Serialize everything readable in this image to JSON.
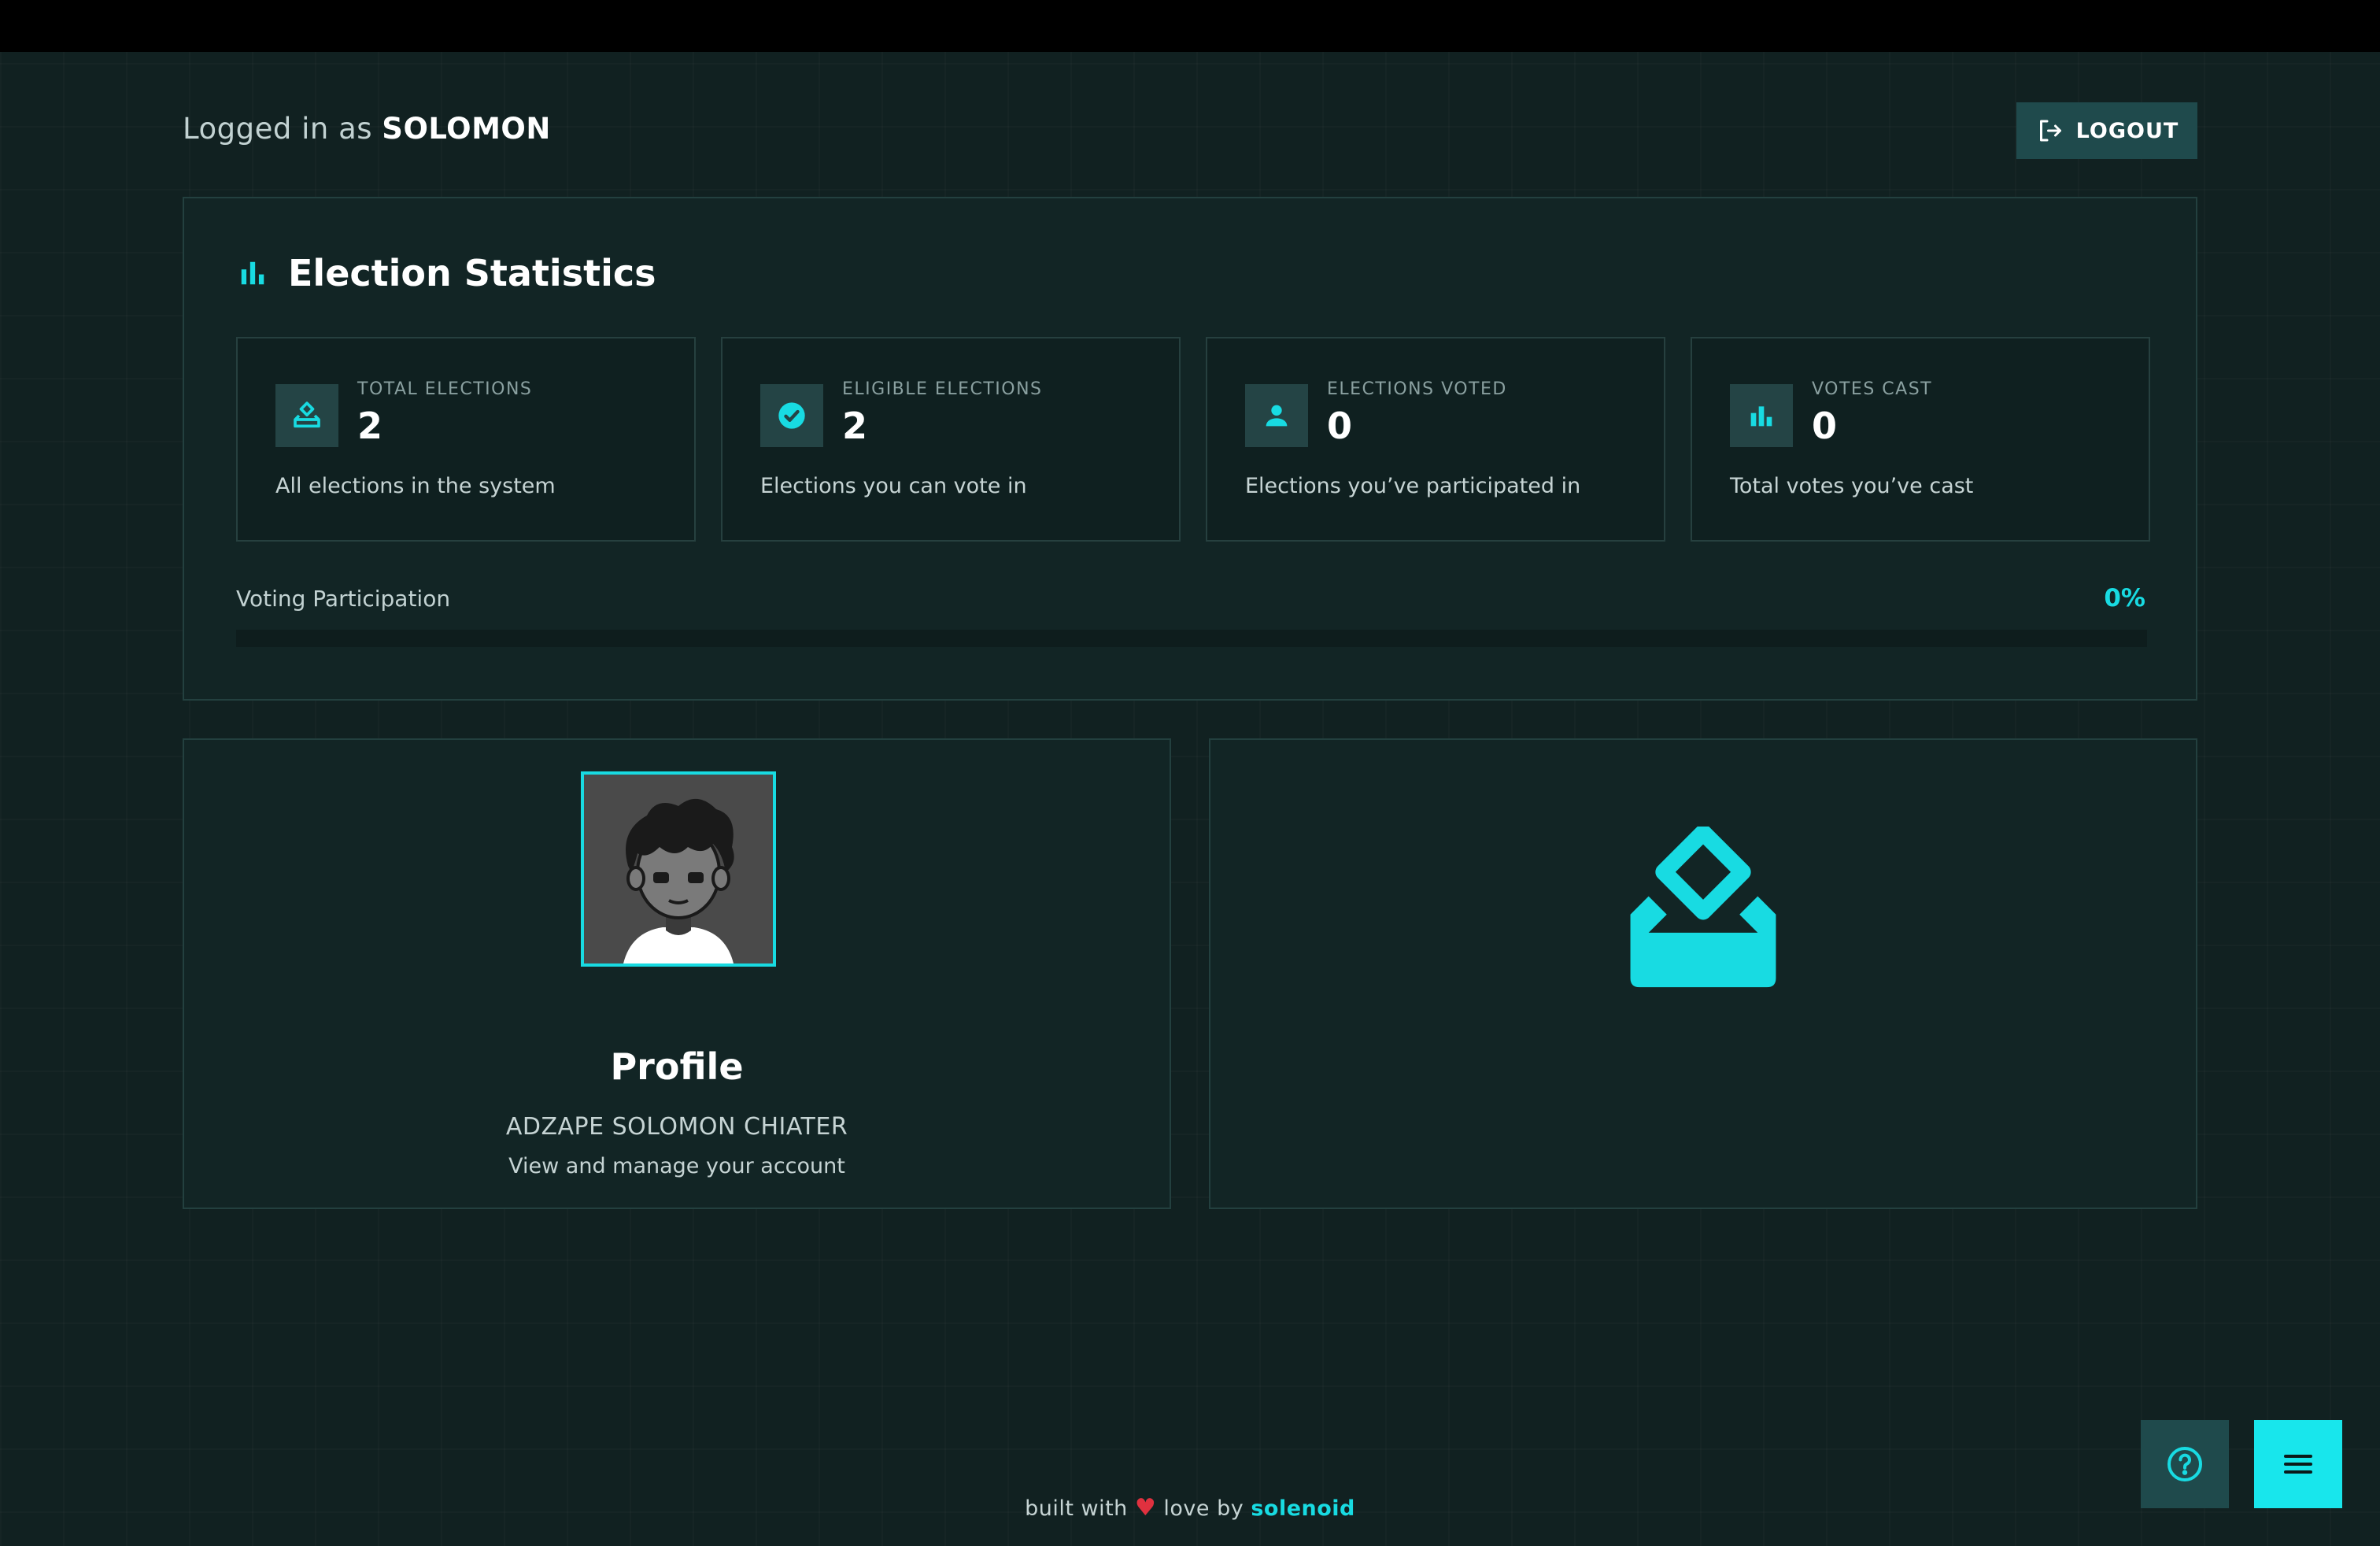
{
  "header": {
    "logged_prefix": "Logged in as",
    "username": "SOLOMON",
    "logout_label": "LOGOUT"
  },
  "stats": {
    "title": "Election Statistics",
    "cards": [
      {
        "label": "TOTAL ELECTIONS",
        "value": "2",
        "desc": "All elections in the system",
        "icon": "ballot-icon"
      },
      {
        "label": "ELIGIBLE ELECTIONS",
        "value": "2",
        "desc": "Elections you can vote in",
        "icon": "check-circle-icon"
      },
      {
        "label": "ELECTIONS VOTED",
        "value": "0",
        "desc": "Elections you’ve participated in",
        "icon": "person-icon"
      },
      {
        "label": "VOTES CAST",
        "value": "0",
        "desc": "Total votes you’ve cast",
        "icon": "bar-chart-icon"
      }
    ],
    "participation": {
      "label": "Voting Participation",
      "percent_label": "0%",
      "percent": 0
    }
  },
  "profile": {
    "title": "Profile",
    "name": "ADZAPE SOLOMON CHIATER",
    "subtitle": "View and manage your account"
  },
  "vote_panel": {
    "icon": "ballot-box-icon"
  },
  "footer": {
    "built_with": "built with",
    "heart": "♥",
    "love": "love",
    "by": "by",
    "brand": "solenoid"
  },
  "colors": {
    "accent": "#18dbe2",
    "background": "#112121",
    "panel": "#122525",
    "button": "#1f4a4c",
    "heart": "#e0313f"
  }
}
